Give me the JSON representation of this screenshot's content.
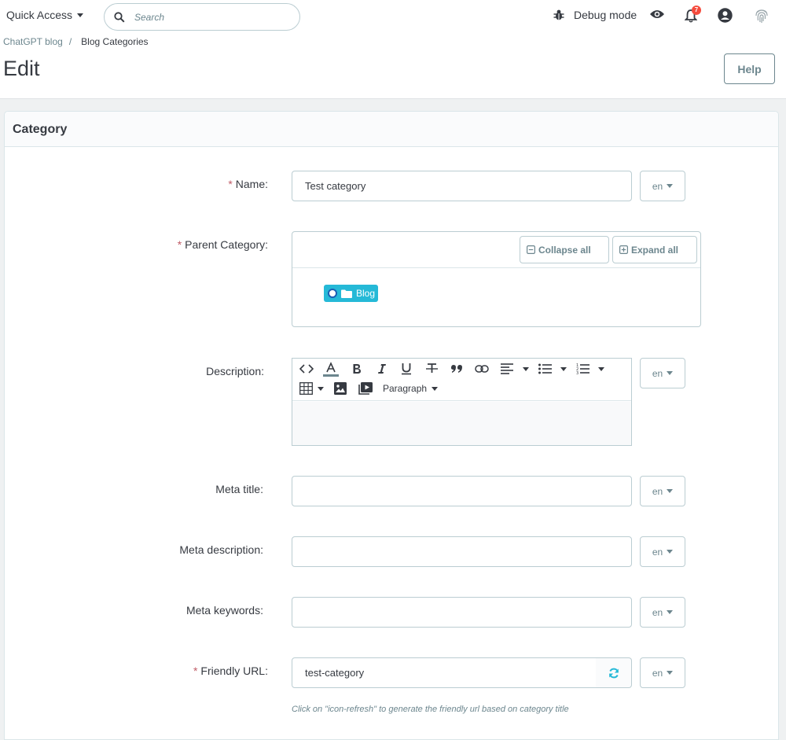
{
  "header": {
    "quick_access_label": "Quick Access",
    "search_placeholder": "Search",
    "debug_mode_label": "Debug mode",
    "notification_count": "7"
  },
  "breadcrumb": {
    "items": [
      "ChatGPT blog",
      "Blog Categories"
    ],
    "separator": "/"
  },
  "page": {
    "title": "Edit",
    "help_label": "Help"
  },
  "card": {
    "title": "Category"
  },
  "form": {
    "required_marker": "*",
    "name": {
      "label": "Name:",
      "value": "Test category",
      "lang": "en"
    },
    "parent_category": {
      "label": "Parent Category:",
      "collapse_all_label": "Collapse all",
      "expand_all_label": "Expand all",
      "tree_nodes": [
        "Blog"
      ]
    },
    "description": {
      "label": "Description:",
      "lang": "en",
      "toolbar": {
        "paragraph_label": "Paragraph",
        "icons": [
          "code-view-icon",
          "font-color-icon",
          "bold-icon",
          "italic-icon",
          "underline-icon",
          "strikethrough-icon",
          "blockquote-icon",
          "link-icon",
          "align-icon",
          "bullet-list-icon",
          "numbered-list-icon",
          "table-icon",
          "image-icon",
          "video-icon"
        ]
      }
    },
    "meta_title": {
      "label": "Meta title:",
      "value": "",
      "lang": "en"
    },
    "meta_description": {
      "label": "Meta description:",
      "value": "",
      "lang": "en"
    },
    "meta_keywords": {
      "label": "Meta keywords:",
      "value": "",
      "lang": "en"
    },
    "friendly_url": {
      "label": "Friendly URL:",
      "value": "test-category",
      "lang": "en",
      "hint": "Click on \"icon-refresh\" to generate the friendly url based on category title"
    }
  },
  "colors": {
    "accent": "#25b9d7",
    "required": "#c05c67",
    "badge": "#f54c3e",
    "text": "#363a41",
    "muted": "#6c868e"
  }
}
